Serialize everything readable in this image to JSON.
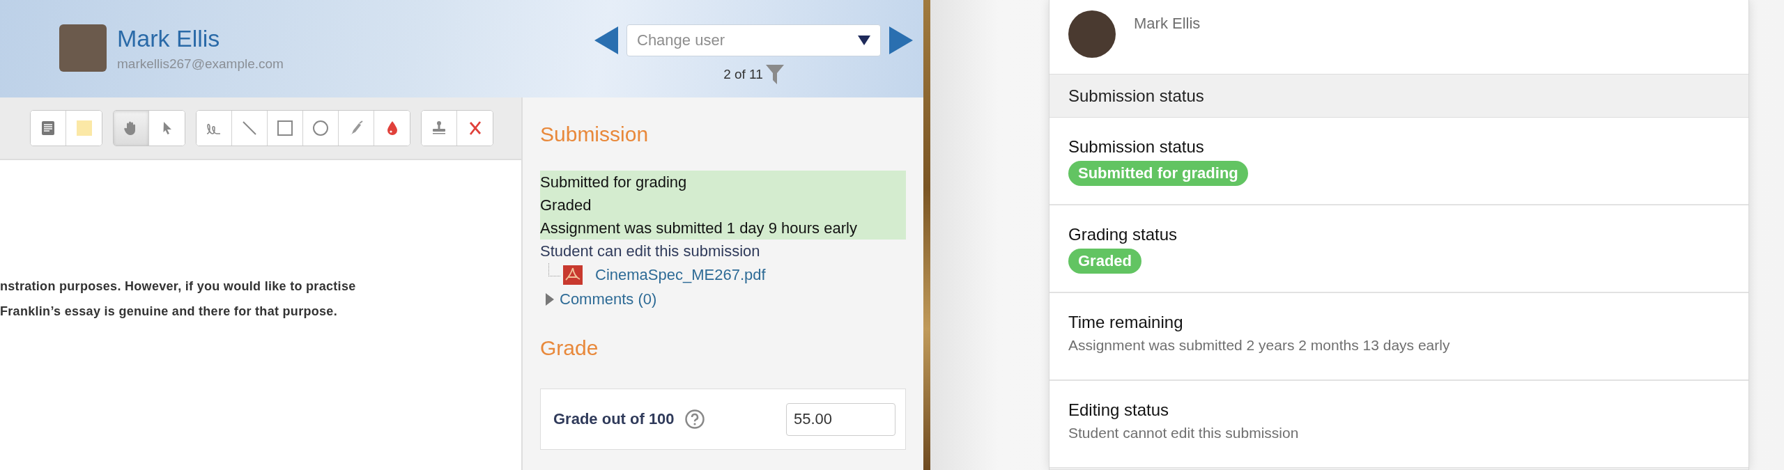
{
  "header": {
    "user_name": "Mark Ellis",
    "user_email": "markellis267@example.com",
    "change_user": {
      "placeholder": "Change user"
    },
    "position": "2 of 11"
  },
  "toolbar": {
    "groups": [
      {
        "tools": [
          {
            "kind": "comment",
            "selected": false
          },
          {
            "kind": "colour",
            "selected": false
          }
        ]
      },
      {
        "tools": [
          {
            "kind": "pan",
            "selected": true
          },
          {
            "kind": "select",
            "selected": false
          }
        ]
      },
      {
        "tools": [
          {
            "kind": "pen",
            "selected": false
          },
          {
            "kind": "line",
            "selected": false
          },
          {
            "kind": "rectangle",
            "selected": false
          },
          {
            "kind": "oval",
            "selected": false
          },
          {
            "kind": "highlight",
            "selected": false
          },
          {
            "kind": "ink",
            "selected": false
          }
        ]
      },
      {
        "tools": [
          {
            "kind": "stamp",
            "selected": false
          },
          {
            "kind": "erase",
            "selected": false
          }
        ]
      }
    ]
  },
  "document": {
    "lines": [
      "nstration purposes.  However, if you would like to practise",
      "Franklin’s essay is genuine and there for that purpose."
    ]
  },
  "submission": {
    "title": "Submission",
    "status_lines": [
      "Submitted for grading",
      "Graded",
      "Assignment was submitted 1 day 9 hours early"
    ],
    "edit_note": "Student can edit this submission",
    "files": [
      "CinemaSpec_ME267.pdf"
    ],
    "comments": {
      "label": "Comments (0)",
      "expanded": false
    }
  },
  "grade": {
    "title": "Grade",
    "label": "Grade out of 100",
    "value": "55.00"
  },
  "mobile": {
    "user_name": "Mark Ellis",
    "section_title": "Submission status",
    "rows": [
      {
        "kind": "badge",
        "label": "Submission status",
        "value": "Submitted for grading"
      },
      {
        "kind": "badge",
        "label": "Grading status",
        "value": "Graded"
      },
      {
        "kind": "text",
        "label": "Time remaining",
        "value": "Assignment was submitted 2 years 2 months 13 days early"
      },
      {
        "kind": "text",
        "label": "Editing status",
        "value": "Student cannot edit this submission"
      }
    ]
  }
}
